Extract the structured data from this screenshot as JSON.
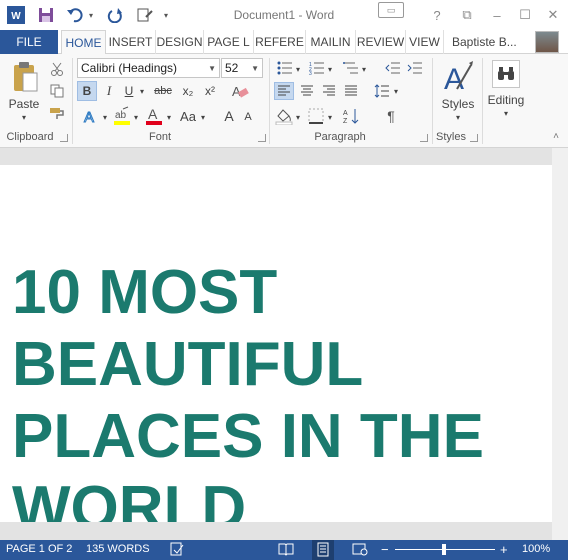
{
  "app": {
    "window_title": "Document1 - Word",
    "colors": {
      "accent": "#2b579a",
      "headline": "#1b7a6e",
      "ribbon_bg": "#f8f8f8",
      "doc_bg": "#e3e3e3"
    }
  },
  "quick_access": [
    {
      "name": "word-logo-icon"
    },
    {
      "name": "save-icon"
    },
    {
      "name": "undo-icon"
    },
    {
      "name": "redo-icon"
    },
    {
      "name": "touch-mode-icon"
    },
    {
      "name": "customize-qat-icon"
    }
  ],
  "window_controls": {
    "help": "?",
    "restore_ribbon": "⧉",
    "minimize": "–",
    "maximize": "☐",
    "close": "✕"
  },
  "tabs": {
    "file": "FILE",
    "items": [
      "HOME",
      "INSERT",
      "DESIGN",
      "PAGE L",
      "REFERE",
      "MAILIN",
      "REVIEW",
      "VIEW"
    ],
    "active": "HOME",
    "user": "Baptiste B..."
  },
  "ribbon": {
    "clipboard": {
      "label": "Clipboard",
      "paste": "Paste"
    },
    "font": {
      "label": "Font",
      "font_name": "Calibri (Headings)",
      "font_size": "52",
      "bold": "B",
      "italic": "I",
      "underline": "U",
      "strike": "abc",
      "subscript": "x₂",
      "superscript": "x²",
      "grow": "A",
      "shrink": "A",
      "change_case": "Aa"
    },
    "paragraph": {
      "label": "Paragraph"
    },
    "styles": {
      "label": "Styles",
      "button": "Styles"
    },
    "editing": {
      "button": "Editing"
    }
  },
  "document": {
    "headline_lines": [
      "10 MOST",
      "BEAUTIFUL",
      "PLACES IN THE",
      "WORLD"
    ]
  },
  "status_bar": {
    "page": "PAGE 1 OF 2",
    "words": "135 WORDS",
    "zoom": "100%",
    "zoom_minus": "−",
    "zoom_plus": "+",
    "zoom_level": 1.0
  }
}
